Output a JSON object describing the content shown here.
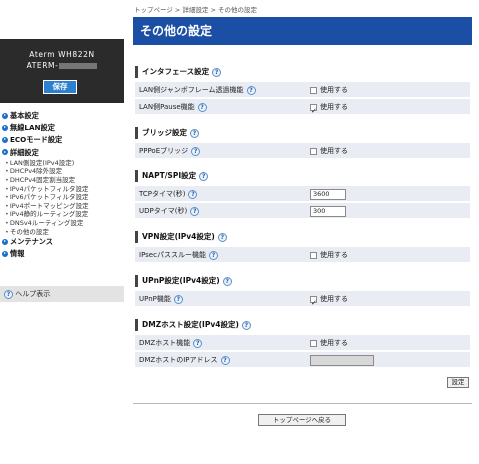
{
  "brand": {
    "model": "Aterm WH822N",
    "host_prefix": "ATERM-",
    "save_label": "保存"
  },
  "nav": {
    "basic": "基本設定",
    "wlan": "無線LAN設定",
    "eco": "ECOモード設定",
    "detail": "詳細設定",
    "sub_items": [
      "LAN側設定(IPv4設定)",
      "DHCPv4除外設定",
      "DHCPv4固定割当設定",
      "IPv4パケットフィルタ設定",
      "IPv6パケットフィルタ設定",
      "IPv4ポートマッピング設定",
      "IPv4静的ルーティング設定",
      "DNSv4ルーティング設定",
      "その他の設定"
    ],
    "maintenance": "メンテナンス",
    "info": "情報",
    "help": "ヘルプ表示"
  },
  "breadcrumb": "トップページ > 詳細設定 > その他の設定",
  "page_title": "その他の設定",
  "sections": {
    "interface": {
      "title": "インタフェース設定",
      "rows": [
        {
          "label": "LAN側ジャンボフレーム透過機能",
          "value": "使用する",
          "checked": false
        },
        {
          "label": "LAN側Pause機能",
          "value": "使用する",
          "checked": true
        }
      ]
    },
    "bridge": {
      "title": "ブリッジ設定",
      "rows": [
        {
          "label": "PPPoEブリッジ",
          "value": "使用する",
          "checked": false
        }
      ]
    },
    "napt": {
      "title": "NAPT/SPI設定",
      "rows": [
        {
          "label": "TCPタイマ(秒)",
          "value": "3600"
        },
        {
          "label": "UDPタイマ(秒)",
          "value": "300"
        }
      ]
    },
    "vpn": {
      "title": "VPN設定(IPv4設定)",
      "rows": [
        {
          "label": "IPsecパススルー機能",
          "value": "使用する",
          "checked": false
        }
      ]
    },
    "upnp": {
      "title": "UPnP設定(IPv4設定)",
      "rows": [
        {
          "label": "UPnP機能",
          "value": "使用する",
          "checked": true
        }
      ]
    },
    "dmz": {
      "title": "DMZホスト設定(IPv4設定)",
      "rows": [
        {
          "label": "DMZホスト機能",
          "value": "使用する",
          "checked": false
        },
        {
          "label": "DMZホストのIPアドレス",
          "value": ""
        }
      ]
    }
  },
  "buttons": {
    "set": "設定",
    "back_to_top": "トップページへ戻る"
  },
  "help_glyph": "?",
  "colors": {
    "title_bar": "#1b4fa5",
    "brand_bg": "#2b2b2b",
    "save_button": "#2d7fd0",
    "row_bg": "#e9edf3"
  }
}
